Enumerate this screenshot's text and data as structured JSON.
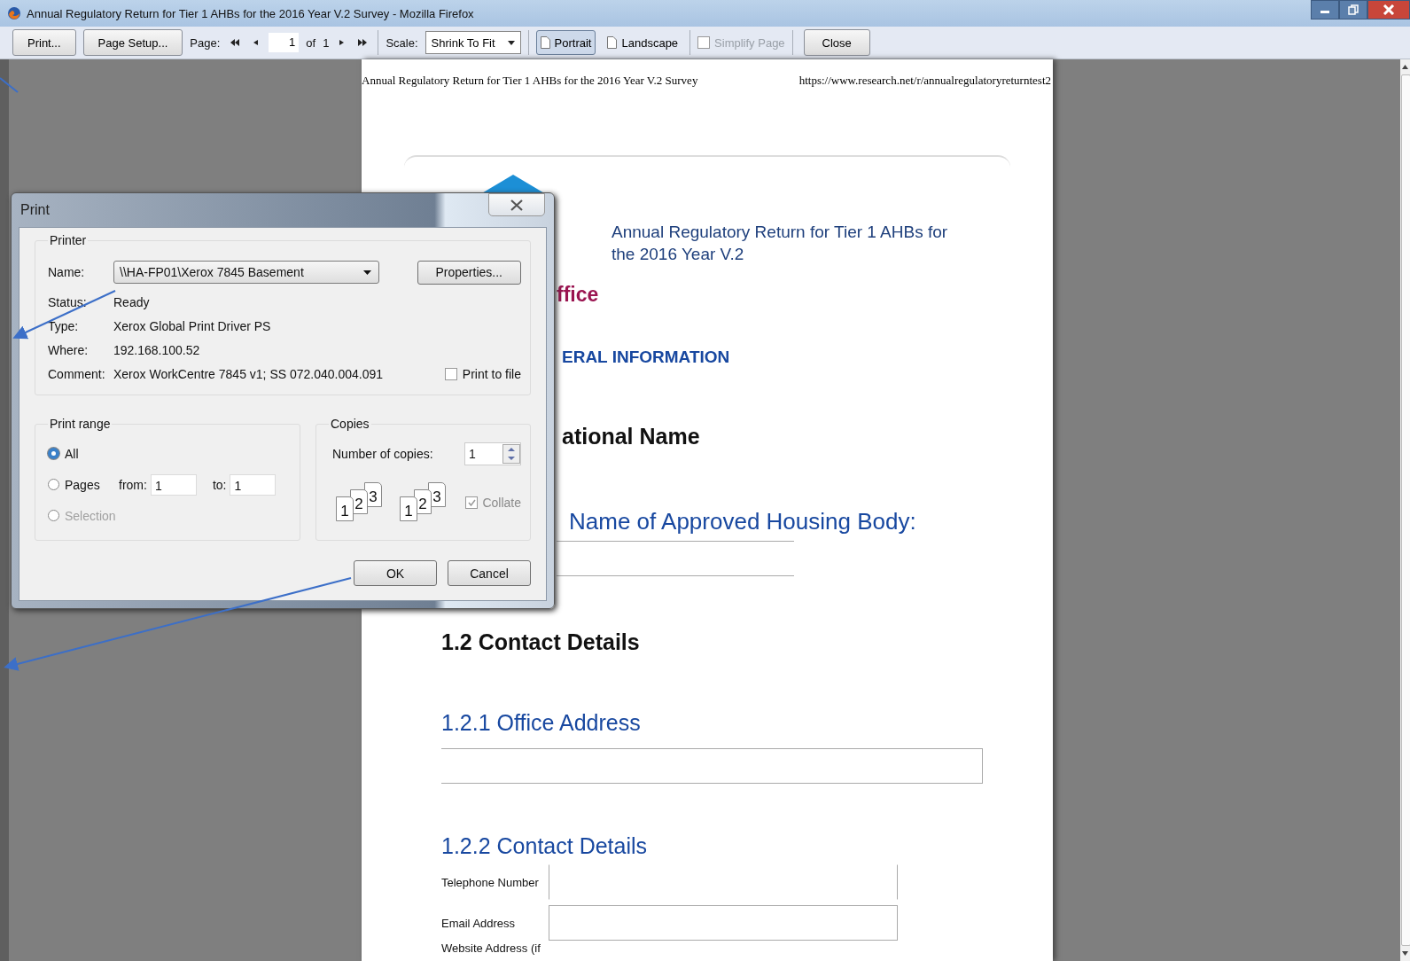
{
  "window": {
    "title": "Annual Regulatory Return for Tier 1 AHBs for the 2016 Year V.2 Survey - Mozilla Firefox"
  },
  "toolbar": {
    "print_button": "Print...",
    "page_setup_button": "Page Setup...",
    "page_label": "Page:",
    "page_value": "1",
    "of_label": "of",
    "page_count": "1",
    "scale_label": "Scale:",
    "scale_value": "Shrink To Fit",
    "orientation": [
      {
        "label": "Portrait",
        "selected": true
      },
      {
        "label": "Landscape",
        "selected": false
      }
    ],
    "simplify": {
      "label": "Simplify Page",
      "checked": false,
      "disabled": true
    },
    "close_button": "Close"
  },
  "page": {
    "header_left": "Annual Regulatory Return for Tier 1 AHBs for the 2016 Year V.2 Survey",
    "header_right": "https://www.research.net/r/annualregulatoryreturntest2",
    "survey_title": "Annual Regulatory Return for Tier 1 AHBs for the 2016 Year V.2",
    "logo_fragment": "ffice",
    "section_heading": "ERAL INFORMATION",
    "subsection_heading": "ational Name",
    "question": "Name of Approved Housing Body:",
    "contact_heading": "1.2 Contact Details",
    "office_address": "1.2.1 Office Address",
    "contact_details": "1.2.2 Contact Details",
    "fields": [
      {
        "label": "Telephone Number"
      },
      {
        "label": "Email Address"
      },
      {
        "label": "Website Address (if"
      }
    ]
  },
  "dialog": {
    "title": "Print",
    "printer": {
      "legend": "Printer",
      "name_label": "Name:",
      "name_value": "\\\\HA-FP01\\Xerox 7845 Basement",
      "properties_button": "Properties...",
      "rows": [
        {
          "label": "Status:",
          "value": "Ready"
        },
        {
          "label": "Type:",
          "value": "Xerox Global Print Driver PS"
        },
        {
          "label": "Where:",
          "value": "192.168.100.52"
        },
        {
          "label": "Comment:",
          "value": "Xerox WorkCentre 7845 v1; SS 072.040.004.091"
        }
      ],
      "print_to_file": {
        "label": "Print to file",
        "checked": false
      }
    },
    "print_range": {
      "legend": "Print range",
      "options": [
        {
          "label": "All",
          "selected": true,
          "disabled": false
        },
        {
          "label": "Pages",
          "selected": false,
          "disabled": false
        },
        {
          "label": "Selection",
          "selected": false,
          "disabled": true
        }
      ],
      "from_label": "from:",
      "from_value": "1",
      "to_label": "to:",
      "to_value": "1"
    },
    "copies": {
      "legend": "Copies",
      "count_label": "Number of copies:",
      "count_value": "1",
      "stacks": [
        [
          "1",
          "2",
          "3"
        ],
        [
          "1",
          "2",
          "3"
        ]
      ],
      "collate": {
        "label": "Collate",
        "checked": true,
        "disabled": true
      }
    },
    "buttons": [
      "OK",
      "Cancel"
    ]
  }
}
